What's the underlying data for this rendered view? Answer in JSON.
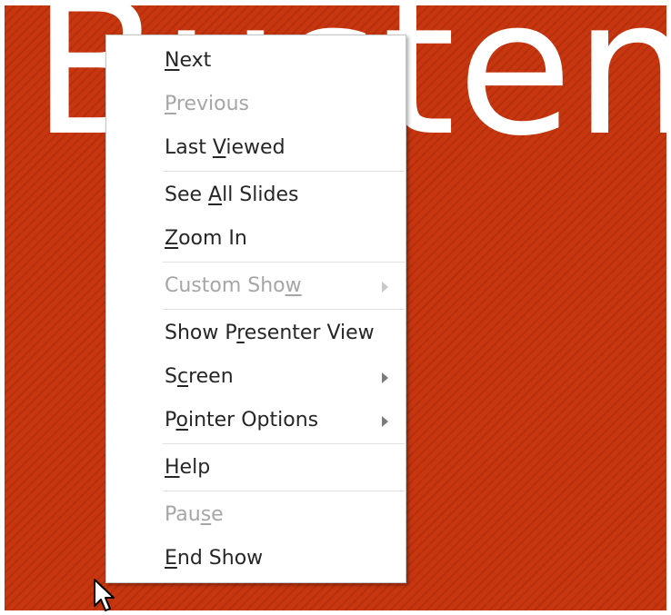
{
  "slide": {
    "title": "Busten",
    "background_color": "#c8360f"
  },
  "context_menu": {
    "items": [
      {
        "label": "Next",
        "accel": "N",
        "enabled": true,
        "submenu": false
      },
      {
        "label": "Previous",
        "accel": "P",
        "enabled": false,
        "submenu": false
      },
      {
        "label": "Last Viewed",
        "accel": "V",
        "enabled": true,
        "submenu": false
      },
      {
        "label": "See All Slides",
        "accel": "A",
        "enabled": true,
        "submenu": false
      },
      {
        "label": "Zoom In",
        "accel": "Z",
        "enabled": true,
        "submenu": false
      },
      {
        "label": "Custom Show",
        "accel": "w",
        "enabled": false,
        "submenu": true
      },
      {
        "label": "Show Presenter View",
        "accel": "r",
        "enabled": true,
        "submenu": false
      },
      {
        "label": "Screen",
        "accel": "c",
        "enabled": true,
        "submenu": true
      },
      {
        "label": "Pointer Options",
        "accel": "o",
        "enabled": true,
        "submenu": true
      },
      {
        "label": "Help",
        "accel": "H",
        "enabled": true,
        "submenu": false
      },
      {
        "label": "Pause",
        "accel": "s",
        "enabled": false,
        "submenu": false
      },
      {
        "label": "End Show",
        "accel": "E",
        "enabled": true,
        "submenu": false
      }
    ]
  },
  "icons": {
    "cursor": "mouse-pointer-icon",
    "submenu_arrow": "chevron-right-icon"
  },
  "colors": {
    "menu_text": "#262626",
    "menu_text_disabled": "#a6a6a6",
    "menu_background": "#ffffff"
  }
}
